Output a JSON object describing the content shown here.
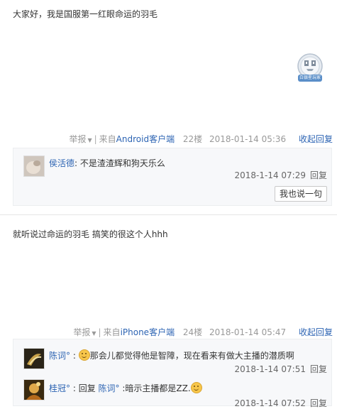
{
  "posts": [
    {
      "content": "大家好，我是国服第一红眼命运的羽毛",
      "badge_label": "白银星玩家",
      "tail": {
        "report": "举报",
        "from_prefix": "来自",
        "client": "Android客户端",
        "floor": "22楼",
        "date": "2018-01-14 05:36",
        "fold": "收起回复"
      },
      "comments": [
        {
          "name": "侯活德",
          "text": "不是渣渣辉和狗天乐么",
          "time": "2018-1-14 07:29",
          "reply": "回复"
        }
      ],
      "say_button": "我也说一句"
    },
    {
      "content": "就听说过命运的羽毛 搞笑的很这个人hhh",
      "tail": {
        "report": "举报",
        "from_prefix": "来自",
        "client": "iPhone客户端",
        "floor": "24楼",
        "date": "2018-01-14 05:47",
        "fold": "收起回复"
      },
      "comments": [
        {
          "name": "陈词°",
          "text": "那会儿都觉得他是智障，现在看来有做大主播的潜质啊",
          "time": "2018-1-14 07:51",
          "reply": "回复"
        },
        {
          "name": "桂冠°",
          "reply_prefix": "回复",
          "reply_to": "陈词°",
          "text": "暗示主播都是ZZ.",
          "time": "2018-1-14 07:52",
          "reply": "回复"
        }
      ]
    }
  ],
  "colors": {
    "link": "#2d64b3",
    "comment_bg": "#f7f8fa",
    "muted": "#999999"
  }
}
